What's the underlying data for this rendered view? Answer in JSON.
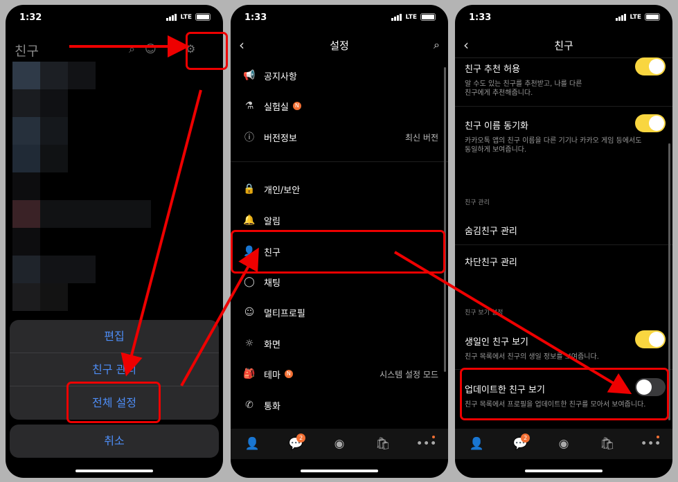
{
  "colors": {
    "accent_red": "#e00000",
    "ios_blue": "#4e8ef7",
    "kakao_yellow": "#f9d640",
    "badge_orange": "#f37034"
  },
  "panel1": {
    "time": "1:32",
    "network": "LTE",
    "title": "친구",
    "sheet_options": [
      "편집",
      "친구 관리",
      "전체 설정"
    ],
    "cancel": "취소"
  },
  "panel2": {
    "time": "1:33",
    "network": "LTE",
    "title": "설정",
    "items": [
      {
        "icon": "megaphone-icon",
        "label": "공지사항"
      },
      {
        "icon": "flask-icon",
        "label": "실험실",
        "badge": "N"
      },
      {
        "icon": "info-icon",
        "label": "버전정보",
        "value": "최신 버전"
      },
      {
        "icon": "lock-icon",
        "label": "개인/보안"
      },
      {
        "icon": "bell-icon",
        "label": "알림"
      },
      {
        "icon": "person-icon",
        "label": "친구"
      },
      {
        "icon": "chat-icon",
        "label": "채팅"
      },
      {
        "icon": "multi-profile-icon",
        "label": "멀티프로필"
      },
      {
        "icon": "brightness-icon",
        "label": "화면"
      },
      {
        "icon": "theme-icon",
        "label": "테마",
        "badge": "N",
        "value": "시스템 설정 모드"
      },
      {
        "icon": "phone-icon",
        "label": "통화"
      }
    ],
    "tab_chat_count": "2"
  },
  "panel3": {
    "time": "1:33",
    "network": "LTE",
    "title": "친구",
    "recommend": {
      "label": "친구 추천 허용",
      "desc1": "알 수도 있는 친구를 추천받고, 나를 다른",
      "desc2": "친구에게 추천해줍니다."
    },
    "sync": {
      "label": "친구 이름 동기화",
      "desc1": "카카오톡 앱의 친구 이름을 다른 기기나 카카오 게임 등에서도",
      "desc2": "동일하게 보여줍니다."
    },
    "manage_section": "친구 관리",
    "hidden": "숨김친구 관리",
    "blocked": "차단친구 관리",
    "view_section": "친구 보기 설정",
    "birthday": {
      "label": "생일인 친구 보기",
      "desc": "친구 목록에서 친구의 생일 정보를 보여줍니다."
    },
    "updated": {
      "label": "업데이트한 친구 보기",
      "desc": "친구 목록에서 프로필을 업데이트한 친구를 모아서 보여줍니다."
    },
    "tab_chat_count": "2"
  }
}
